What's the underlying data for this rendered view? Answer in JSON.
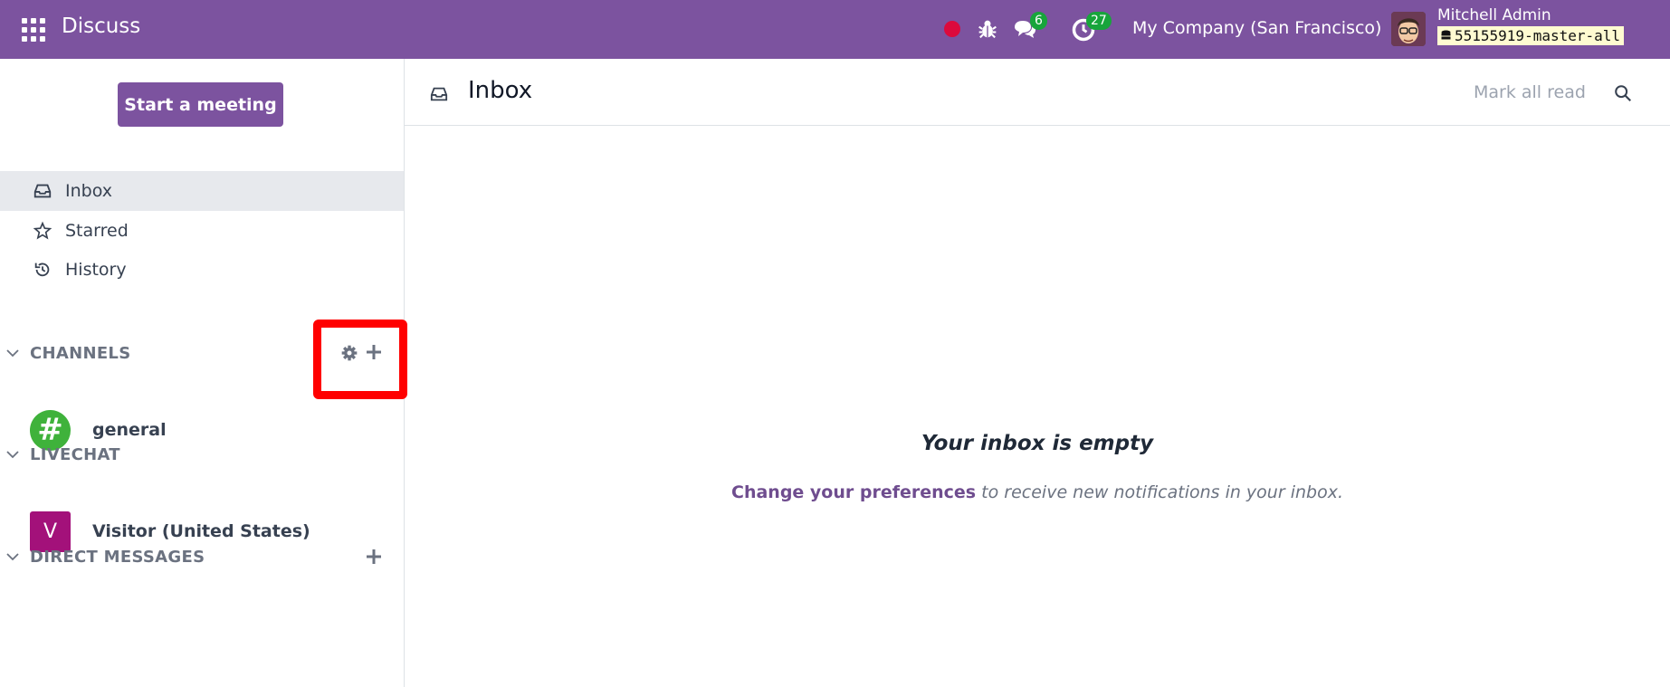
{
  "navbar": {
    "app_name": "Discuss",
    "messages_badge": "6",
    "activities_badge": "27",
    "company": "My Company (San Francisco)",
    "user_name": "Mitchell Admin",
    "database": "55155919-master-all",
    "icons": [
      "apps-grid-icon",
      "recording-dot-icon",
      "bug-icon",
      "chat-bubbles-icon",
      "clock-icon"
    ],
    "colors": {
      "bar": "#7c539f",
      "badge": "#17a53b",
      "record": "#dc0a3c"
    }
  },
  "sidebar": {
    "start_meeting_label": "Start a meeting",
    "nav_items": [
      {
        "label": "Inbox",
        "icon": "inbox-icon",
        "active": true
      },
      {
        "label": "Starred",
        "icon": "star-icon",
        "active": false
      },
      {
        "label": "History",
        "icon": "history-icon",
        "active": false
      }
    ],
    "channels_section": {
      "title": "CHANNELS",
      "actions": [
        "gear-icon",
        "plus-icon"
      ],
      "items": [
        {
          "label": "general",
          "avatar_text": "#",
          "avatar_color": "#3fb23b"
        }
      ]
    },
    "livechat_section": {
      "title": "LIVECHAT",
      "items": [
        {
          "label": "Visitor (United States)",
          "avatar_text": "V",
          "avatar_color": "#a3117a"
        }
      ]
    },
    "dm_section": {
      "title": "DIRECT MESSAGES",
      "actions": [
        "plus-icon"
      ]
    }
  },
  "main": {
    "title": "Inbox",
    "mark_all_read": "Mark all read",
    "empty_title": "Your inbox is empty",
    "empty_link": "Change your preferences",
    "empty_text": "to receive new notifications in your inbox."
  }
}
